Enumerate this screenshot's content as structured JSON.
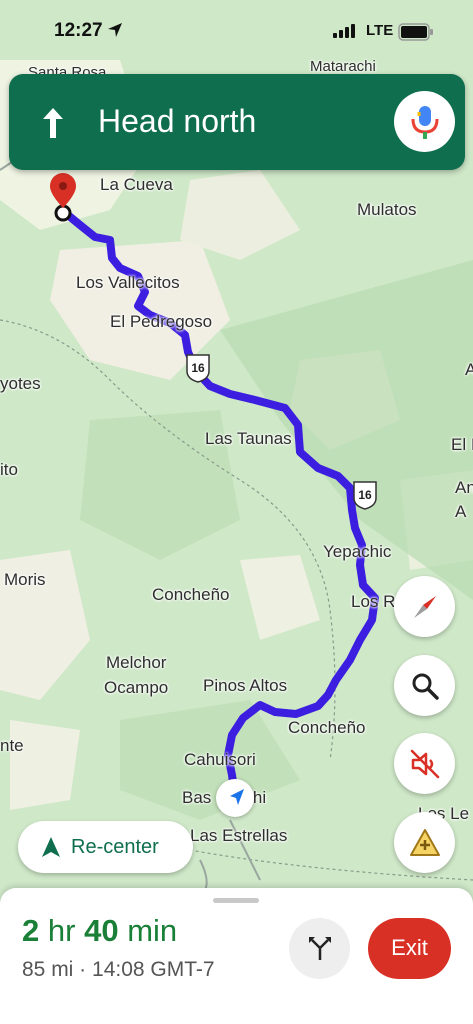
{
  "status_bar": {
    "time": "12:27",
    "network": "LTE"
  },
  "navigation": {
    "instruction": "Head north",
    "maneuver_icon": "arrow-up-icon",
    "voice_icon": "mic-icon"
  },
  "map": {
    "highway_number": "16",
    "places": {
      "top_town": "Matarachi",
      "top_left_town": "Santa Rosa",
      "la_cueva": "La Cueva",
      "mulatos": "Mulatos",
      "los_vallecitos": "Los Vallecitos",
      "el_pedregoso": "El Pedregoso",
      "left_yotes": "yotes",
      "right_a1": "A",
      "las_taunas": "Las Taunas",
      "right_el": "El I",
      "left_ito": "ito",
      "right_an": "An",
      "right_a2": "A",
      "yepachic": "Yepachic",
      "moris": "Moris",
      "concheno_left": "Concheño",
      "los_r": "Los R",
      "melchor": "Melchor",
      "ocampo": "Ocampo",
      "pinos_altos": "Pinos Altos",
      "concheno_right": "Concheño",
      "left_nte": "nte",
      "cahuisori": "Cahuisori",
      "basaseachi": "Bas     achi",
      "los_le": "Los Le",
      "las_estrellas": "Las Estrellas"
    }
  },
  "controls": {
    "compass_icon": "compass-icon",
    "search_icon": "search-icon",
    "mute_icon": "sound-off-icon",
    "report_icon": "add-report-icon",
    "recenter_label": "Re-center"
  },
  "trip": {
    "eta_hours": "2",
    "eta_hours_unit": "hr",
    "eta_minutes": "40",
    "eta_minutes_unit": "min",
    "details": "85 mi · 14:08 GMT-7",
    "route_options_icon": "route-split-icon",
    "exit_label": "Exit"
  },
  "colors": {
    "banner": "#0f6e4e",
    "route": "#3c1ee0",
    "eta_green": "#1a7f37",
    "exit_red": "#d93025"
  }
}
